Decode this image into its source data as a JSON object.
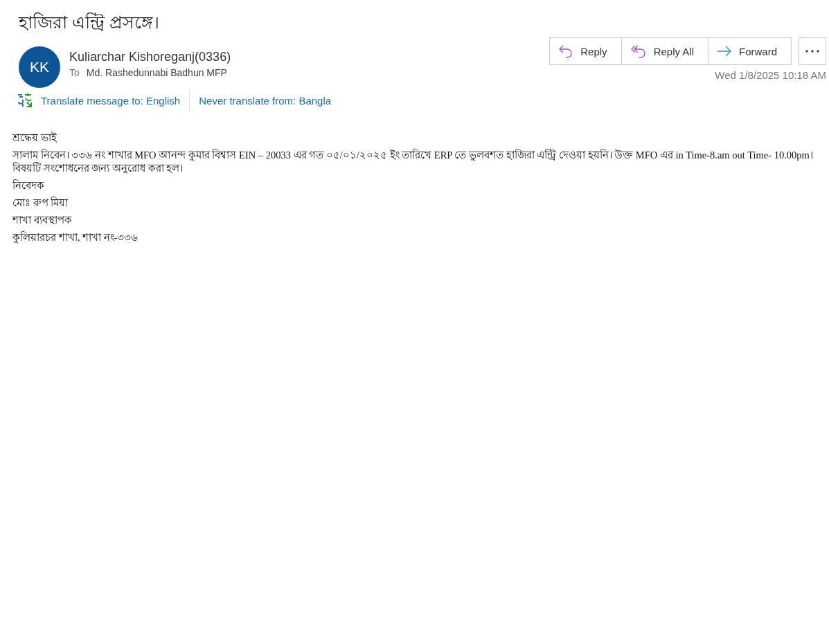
{
  "subject": "হাজিরা এন্ট্রি প্রসঙ্গে।",
  "sender": {
    "initials": "KK",
    "name": "Kuliarchar Kishoreganj(0336)",
    "to_label": "To",
    "to": "Md. Rashedunnabi Badhun MFP"
  },
  "actions": [
    {
      "kind": "reply",
      "label": "Reply"
    },
    {
      "kind": "reply_all",
      "label": "Reply All"
    },
    {
      "kind": "forward",
      "label": "Forward"
    },
    {
      "kind": "more"
    }
  ],
  "date": "Wed 1/8/2025 10:18 AM",
  "translate": {
    "translate_link": "Translate message to: English",
    "never_link": "Never translate from: Bangla"
  },
  "body": [
    "শ্রদ্ধেয় ভাই",
    "সালাম নিবেন। ৩৩৬ নং শাখার MFO আনন্দ কুমার বিশ্বাস EIN – 20033 এর গত ০৫/০১/২০২৫ ইং তারিখে ERP তে ভুলবশত হাজিরা এন্ট্রি দেওয়া হয়নি। উক্ত MFO এর  in Time-8.am  out Time- 10.00pm। বিষয়টি সংশোধনের জন্য অনুরোধ করা হল।",
    "নিবেদক",
    "মোঃ রুপ মিয়া",
    "শাখা ব্যবস্থাপক",
    "কুলিয়ারচর শাখা, শাখা নং-৩৩৬"
  ]
}
